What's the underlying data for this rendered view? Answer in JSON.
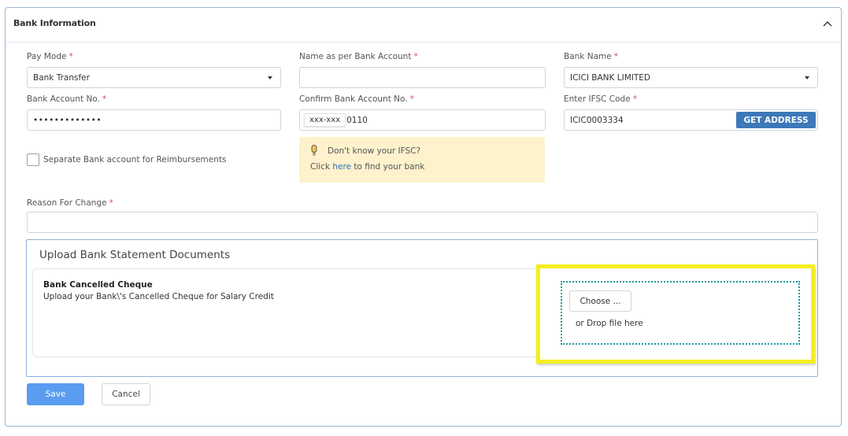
{
  "section": {
    "title": "Bank Information"
  },
  "pay_mode": {
    "label": "Pay Mode",
    "value": "Bank Transfer"
  },
  "name_as_per_bank": {
    "label": "Name as per Bank Account",
    "value": ""
  },
  "bank_name": {
    "label": "Bank Name",
    "value": "ICICI BANK LIMITED"
  },
  "account_no": {
    "label": "Bank Account No.",
    "value": "•••••••••••••"
  },
  "confirm_account_no": {
    "label": "Confirm Bank Account No.",
    "mask": "xxx-xxx",
    "value": "0110"
  },
  "ifsc": {
    "label": "Enter IFSC Code",
    "value": "ICIC0003334",
    "button": "GET ADDRESS"
  },
  "ifsc_help": {
    "line1": "Don't know your IFSC?",
    "prefix": "Click",
    "link": "here",
    "suffix": "to find your bank"
  },
  "reimbursement": {
    "label": "Separate Bank account for Reimbursements",
    "checked": false
  },
  "reason": {
    "label": "Reason For Change",
    "value": ""
  },
  "required_mark": "*",
  "upload": {
    "title": "Upload Bank Statement Documents",
    "doc_title": "Bank Cancelled Cheque",
    "doc_desc": "Upload your Bank\\'s Cancelled Cheque for Salary Credit",
    "choose_button": "Choose ...",
    "drop_text": "or Drop file here"
  },
  "actions": {
    "save": "Save",
    "cancel": "Cancel"
  },
  "colors": {
    "primary": "#5a9cf0",
    "get_address": "#3d78b8",
    "required": "#e0474c",
    "highlight": "#f5ee1d",
    "dropzone_border": "#1a9a9e",
    "ifsc_box": "#fdf2cc"
  }
}
